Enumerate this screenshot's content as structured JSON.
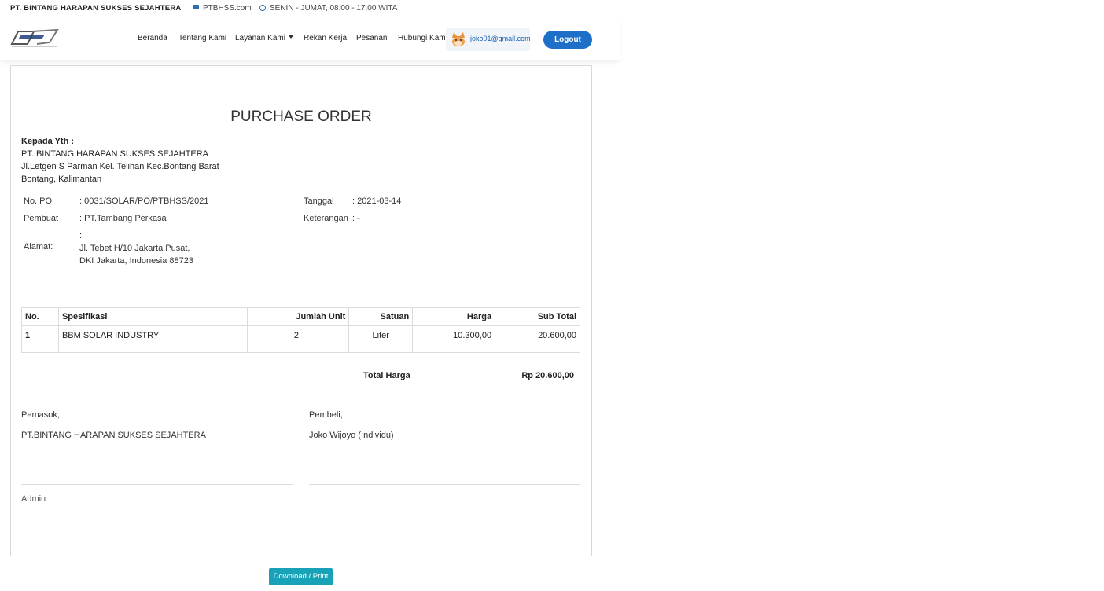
{
  "topbar": {
    "company": "PT. BINTANG HARAPAN SUKSES SEJAHTERA",
    "site": "PTBHSS.com",
    "hours": "SENIN - JUMAT, 08.00 - 17.00 WITA",
    "site_icon": "envelope-icon",
    "hours_icon": "clock-icon"
  },
  "nav": {
    "items": [
      "Beranda",
      "Tentang Kami",
      "Layanan Kami",
      "Rekan Kerja",
      "Pesanan",
      "Hubungi Kami"
    ],
    "user_email": "joko01@gmail.com",
    "logout": "Logout",
    "accent": "#1e6fc7"
  },
  "po": {
    "title": "PURCHASE ORDER",
    "to_label": "Kepada Yth :",
    "to_company": "PT. BINTANG HARAPAN SUKSES SEJAHTERA",
    "to_address1": "Jl.Letgen S Parman Kel. Telihan Kec.Bontang Barat",
    "to_address2": "Bontang, Kalimantan",
    "no_po_label": "No. PO",
    "no_po_value": ": 0031/SOLAR/PO/PTBHSS/2021",
    "pembuat_label": "Pembuat",
    "pembuat_value": ": PT.Tambang Perkasa",
    "alamat_label": "Alamat:",
    "alamat_colon": ":",
    "alamat_line1": "Jl. Tebet H/10 Jakarta Pusat,",
    "alamat_line2": "DKI Jakarta, Indonesia 88723",
    "tanggal_label": "Tanggal",
    "tanggal_value": ": 2021-03-14",
    "keterangan_label": "Keterangan",
    "keterangan_value": ": -"
  },
  "table": {
    "headers": [
      "No.",
      "Spesifikasi",
      "Jumlah Unit",
      "Satuan",
      "Harga",
      "Sub Total"
    ],
    "rows": [
      [
        "1",
        "BBM SOLAR INDUSTRY",
        "2",
        "Liter",
        "10.300,00",
        "20.600,00"
      ]
    ]
  },
  "total": {
    "label": "Total Harga",
    "value": "Rp 20.600,00"
  },
  "signatures": {
    "supplier_label": "Pemasok,",
    "supplier_name": "PT.BINTANG HARAPAN SUKSES SEJAHTERA",
    "buyer_label": "Pembeli,",
    "buyer_name": "Joko Wijoyo (Individu)",
    "admin": "Admin"
  },
  "actions": {
    "download": "Download / Print",
    "download_color": "#17a2b8"
  }
}
